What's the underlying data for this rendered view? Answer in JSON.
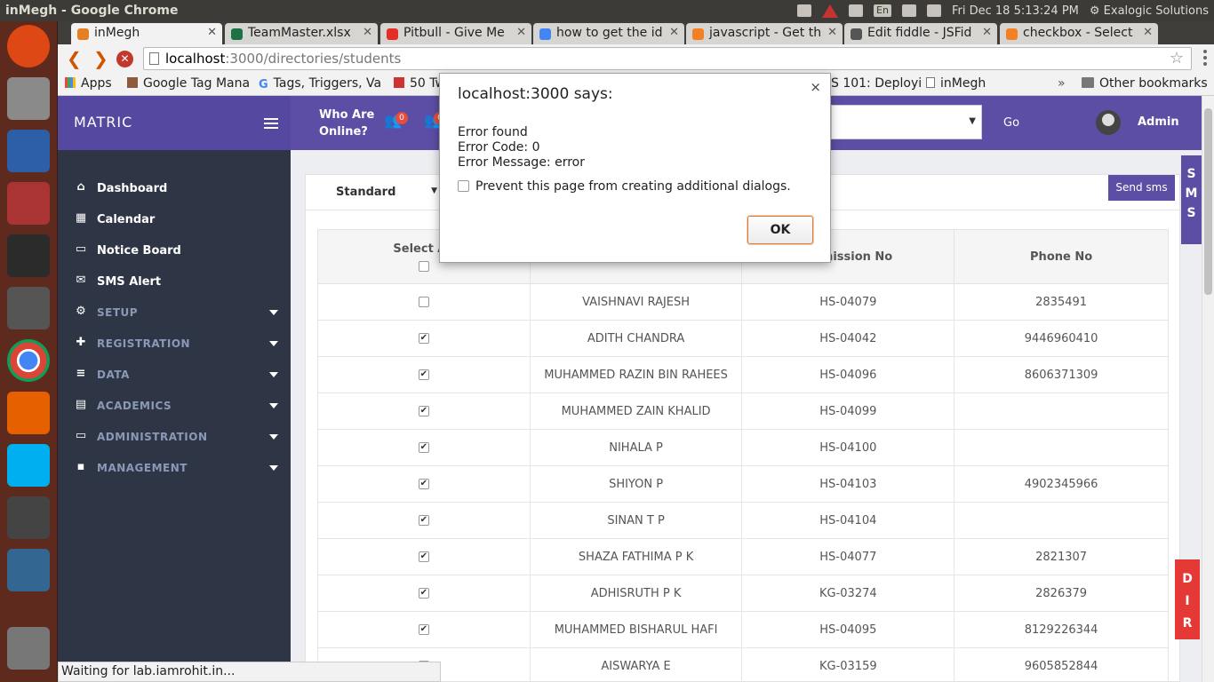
{
  "os": {
    "window_title": "inMegh - Google Chrome",
    "clock": "Fri Dec 18  5:13:24 PM",
    "lang": "En",
    "user": "Exalogic Solutions",
    "tray_icons": [
      "teamviewer-icon",
      "warning-icon",
      "network-icon",
      "keyboard-icon",
      "mail-icon",
      "volume-icon"
    ]
  },
  "launcher": {
    "apps": [
      {
        "name": "ubuntu-dash-icon",
        "color": "#dd4814"
      },
      {
        "name": "files-icon",
        "color": "#8a8a8a"
      },
      {
        "name": "writer-icon",
        "color": "#2d5ea8"
      },
      {
        "name": "settings-icon",
        "color": "#a33"
      },
      {
        "name": "terminal-icon",
        "color": "#2b2b2b"
      },
      {
        "name": "sublime-icon",
        "color": "#555"
      },
      {
        "name": "chrome-icon",
        "color": "#4285f4"
      },
      {
        "name": "firefox-icon",
        "color": "#e66000"
      },
      {
        "name": "skype-icon",
        "color": "#00aff0"
      },
      {
        "name": "pidgin-icon",
        "color": "#444"
      },
      {
        "name": "postgres-icon",
        "color": "#336791"
      },
      {
        "name": "trash-icon",
        "color": "#777"
      }
    ]
  },
  "tabs": [
    {
      "label": "inMegh",
      "color": "#e67e22",
      "active": true
    },
    {
      "label": "TeamMaster.xlsx",
      "color": "#1e7145"
    },
    {
      "label": "Pitbull - Give Me",
      "color": "#e52d27"
    },
    {
      "label": "how to get the id",
      "color": "#4285f4"
    },
    {
      "label": "javascript - Get th",
      "color": "#f48024"
    },
    {
      "label": "Edit fiddle - JSFid",
      "color": "#555"
    },
    {
      "label": "checkbox - Select",
      "color": "#f48024"
    }
  ],
  "omnibox": {
    "host": "localhost",
    "rest": ":3000/directories/students"
  },
  "bookmarks": [
    "Apps",
    "Google Tag Mana",
    "Tags, Triggers, Va",
    "50 Tw",
    "S 101: Deployi",
    "inMegh",
    "Other bookmarks"
  ],
  "header": {
    "brand": "MATRIC",
    "who_online": [
      "Who Are",
      "Online?"
    ],
    "badge1": "0",
    "badge2": "0",
    "go": "Go",
    "admin": "Admin"
  },
  "sidebar": {
    "items": [
      {
        "label": "Dashboard",
        "icon": "⌂",
        "section": false
      },
      {
        "label": "Calendar",
        "icon": "▦",
        "section": false
      },
      {
        "label": "Notice Board",
        "icon": "▭",
        "section": false
      },
      {
        "label": "SMS Alert",
        "icon": "✉",
        "section": false
      },
      {
        "label": "SETUP",
        "icon": "⚙",
        "section": true
      },
      {
        "label": "REGISTRATION",
        "icon": "✚",
        "section": true
      },
      {
        "label": "DATA",
        "icon": "≡",
        "section": true
      },
      {
        "label": "ACADEMICS",
        "icon": "▤",
        "section": true
      },
      {
        "label": "ADMINISTRATION",
        "icon": "▭",
        "section": true
      },
      {
        "label": "MANAGEMENT",
        "icon": "▪",
        "section": true
      }
    ]
  },
  "filter": {
    "standard": "Standard",
    "send_sms": "Send sms"
  },
  "side_tabs": {
    "sms": [
      "S",
      "M",
      "S"
    ],
    "dir": [
      "D",
      "I",
      "R"
    ]
  },
  "table": {
    "headers": [
      "Select All",
      "",
      "Admission No",
      "Phone No"
    ],
    "rows": [
      {
        "checked": false,
        "name": "VAISHNAVI RAJESH",
        "adm": "HS-04079",
        "phone": "2835491"
      },
      {
        "checked": true,
        "name": "ADITH CHANDRA",
        "adm": "HS-04042",
        "phone": "9446960410"
      },
      {
        "checked": true,
        "name": "MUHAMMED RAZIN BIN RAHEES",
        "adm": "HS-04096",
        "phone": "8606371309"
      },
      {
        "checked": true,
        "name": "MUHAMMED ZAIN KHALID",
        "adm": "HS-04099",
        "phone": ""
      },
      {
        "checked": true,
        "name": "NIHALA P",
        "adm": "HS-04100",
        "phone": ""
      },
      {
        "checked": true,
        "name": "SHIYON P",
        "adm": "HS-04103",
        "phone": "4902345966"
      },
      {
        "checked": true,
        "name": "SINAN T P",
        "adm": "HS-04104",
        "phone": ""
      },
      {
        "checked": true,
        "name": "SHAZA FATHIMA P K",
        "adm": "HS-04077",
        "phone": "2821307"
      },
      {
        "checked": true,
        "name": "ADHISRUTH P K",
        "adm": "KG-03274",
        "phone": "2826379"
      },
      {
        "checked": true,
        "name": "MUHAMMED BISHARUL HAFI",
        "adm": "HS-04095",
        "phone": "8129226344"
      },
      {
        "checked": true,
        "name": "AISWARYA E",
        "adm": "KG-03159",
        "phone": "9605852844"
      }
    ]
  },
  "dialog": {
    "title": "localhost:3000 says:",
    "lines": [
      "Error found",
      "Error Code: 0",
      "Error Message: error"
    ],
    "prevent": "Prevent this page from creating additional dialogs.",
    "ok": "OK"
  },
  "status": "Waiting for lab.iamrohit.in..."
}
